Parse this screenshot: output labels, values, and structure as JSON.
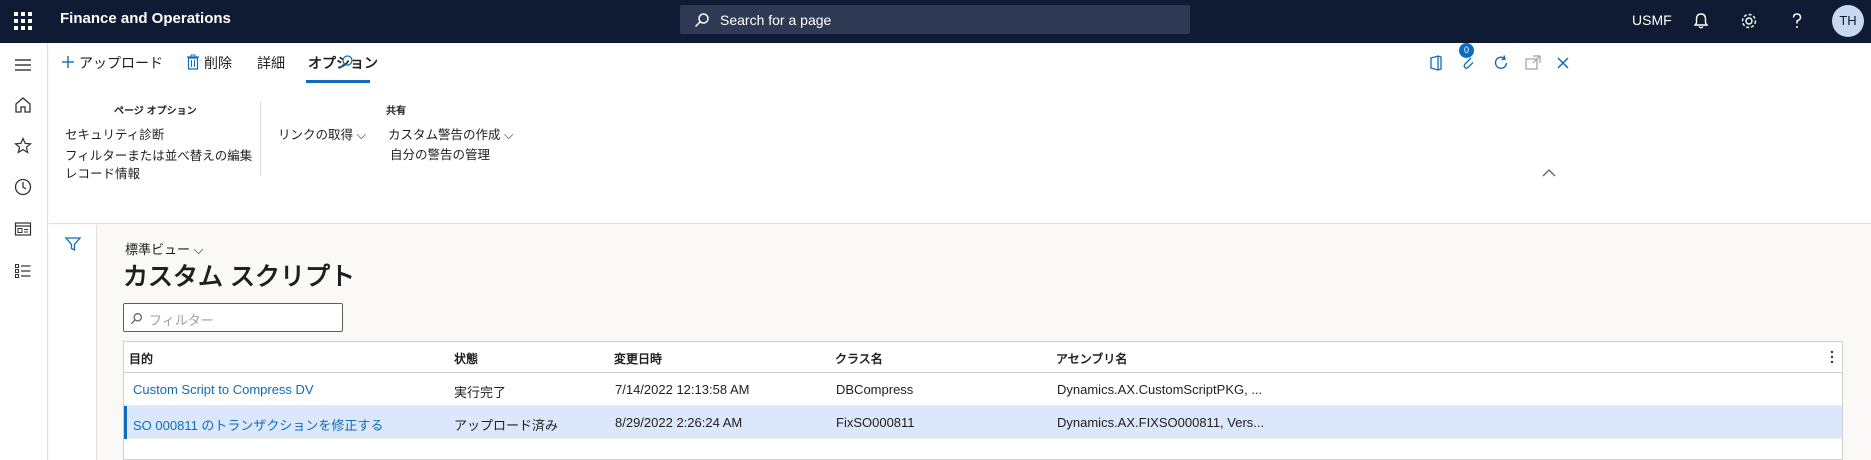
{
  "topbar": {
    "app_title": "Finance and Operations",
    "search_placeholder": "Search for a page",
    "company": "USMF",
    "avatar_initials": "TH"
  },
  "action_pane": {
    "tabs": [
      "アップロード",
      "削除",
      "詳細",
      "オプション"
    ],
    "active_tab": "オプション",
    "groups": [
      {
        "title": "ページ オプション",
        "items": [
          "セキュリティ診断",
          "フィルターまたは並べ替えの編集",
          "レコード情報"
        ]
      },
      {
        "title": "",
        "items": [
          "リンクの取得"
        ]
      },
      {
        "title": "共有",
        "items": [
          "カスタム警告の作成",
          "自分の警告の管理"
        ]
      }
    ],
    "notification_count": "0"
  },
  "content": {
    "view_selector": "標準ビュー",
    "page_title": "カスタム スクリプト",
    "filter_placeholder": "フィルター"
  },
  "grid": {
    "columns": [
      "目的",
      "状態",
      "変更日時",
      "クラス名",
      "アセンブリ名"
    ],
    "rows": [
      [
        "Custom Script to Compress DV",
        "実行完了",
        "7/14/2022 12:13:58 AM",
        "DBCompress",
        "Dynamics.AX.CustomScriptPKG, ..."
      ],
      [
        "SO 000811 のトランザクションを修正する",
        "アップロード済み",
        "8/29/2022 2:26:24 AM",
        "FixSO000811",
        "Dynamics.AX.FIXSO000811, Vers..."
      ]
    ],
    "selected_row": 1
  },
  "colors": {
    "topbar_bg": "#0f1b33",
    "accent": "#0f6cbd",
    "selected_row_bg": "#dbe7fb"
  }
}
